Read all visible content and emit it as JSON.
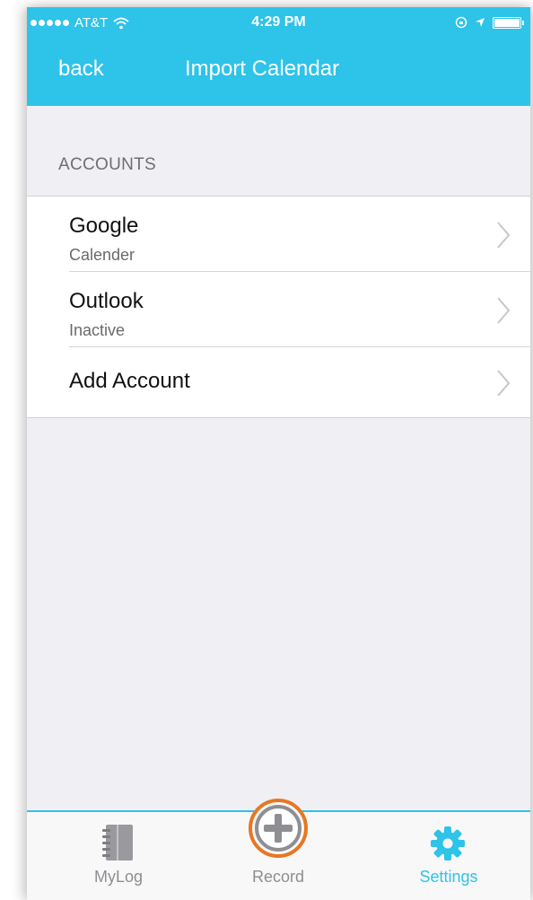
{
  "status_bar": {
    "carrier": "AT&T",
    "time": "4:29 PM"
  },
  "nav": {
    "back_label": "back",
    "title": "Import Calendar"
  },
  "accounts": {
    "section_header": "ACCOUNTS",
    "items": [
      {
        "title": "Google",
        "subtitle": "Calender"
      },
      {
        "title": "Outlook",
        "subtitle": "Inactive"
      },
      {
        "title": "Add Account"
      }
    ]
  },
  "tabbar": {
    "tabs": [
      {
        "label": "MyLog",
        "icon": "notebook-icon",
        "active": false
      },
      {
        "label": "Record",
        "icon": "plus-circle-icon",
        "active": false
      },
      {
        "label": "Settings",
        "icon": "gear-icon",
        "active": true
      }
    ]
  },
  "colors": {
    "accent": "#2ec3e8",
    "record_ring": "#e87722",
    "background": "#efeff4"
  }
}
